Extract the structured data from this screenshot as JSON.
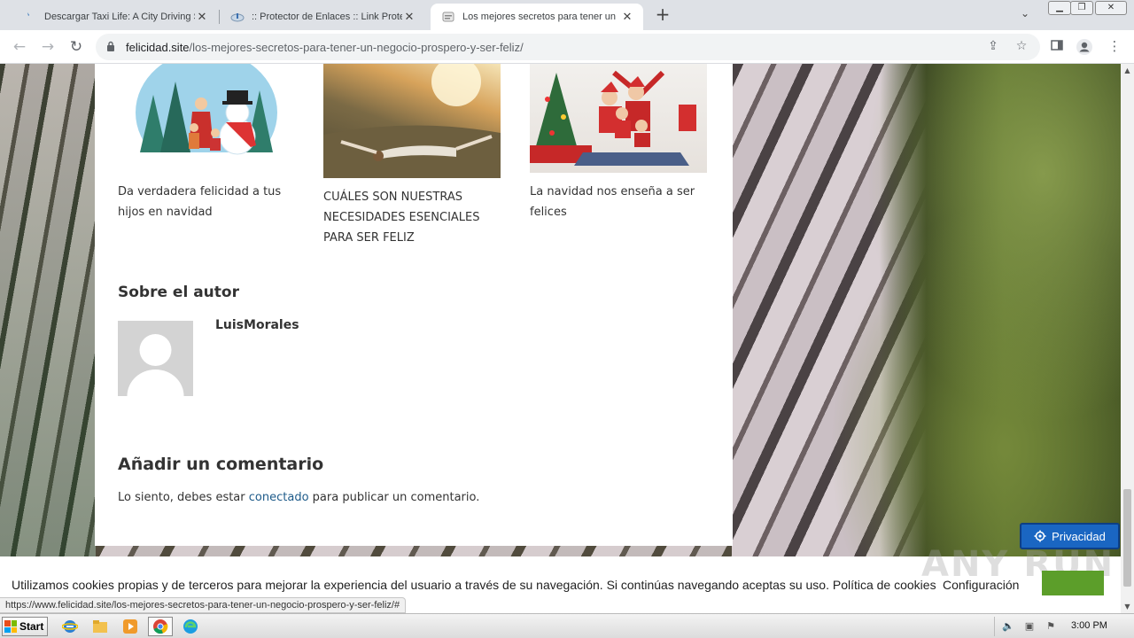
{
  "browser": {
    "tabs": [
      {
        "title": "Descargar Taxi Life: A City Driving Si",
        "icon": "feather-icon"
      },
      {
        "title": ":: Protector de Enlaces :: Link Protec",
        "icon": "cloud-icon"
      },
      {
        "title": "Los mejores secretos para tener un",
        "icon": "page-icon"
      }
    ],
    "active_tab": 2,
    "url_host": "felicidad.site",
    "url_path": "/los-mejores-secretos-para-tener-un-negocio-prospero-y-ser-feliz/",
    "status_url": "https://www.felicidad.site/los-mejores-secretos-para-tener-un-negocio-prospero-y-ser-feliz/#"
  },
  "related_posts": [
    {
      "title": "Da verdadera felicidad a tus hijos en navidad"
    },
    {
      "title": "CUÁLES SON NUESTRAS NECESIDADES ESENCIALES PARA SER FELIZ"
    },
    {
      "title": "La navidad nos enseña a ser felices"
    }
  ],
  "author": {
    "heading": "Sobre el autor",
    "name": "LuisMorales"
  },
  "comments": {
    "heading": "Añadir un comentario",
    "prefix": "Lo siento, debes estar ",
    "link": "conectado",
    "suffix": " para publicar un comentario."
  },
  "cookie_bar": {
    "message": "Utilizamos cookies propias y de terceros para mejorar la experiencia del usuario a través de su navegación. Si continúas navegando aceptas su uso. Política de cookies",
    "config": "Configuración",
    "privacy_button": "Privacidad"
  },
  "watermark": "ANY RUN",
  "taskbar": {
    "start": "Start",
    "clock": "3:00 PM"
  },
  "colors": {
    "link": "#1e5b8a",
    "privacy": "#1a66c2",
    "watermark_badge": "#5c9e2a"
  }
}
